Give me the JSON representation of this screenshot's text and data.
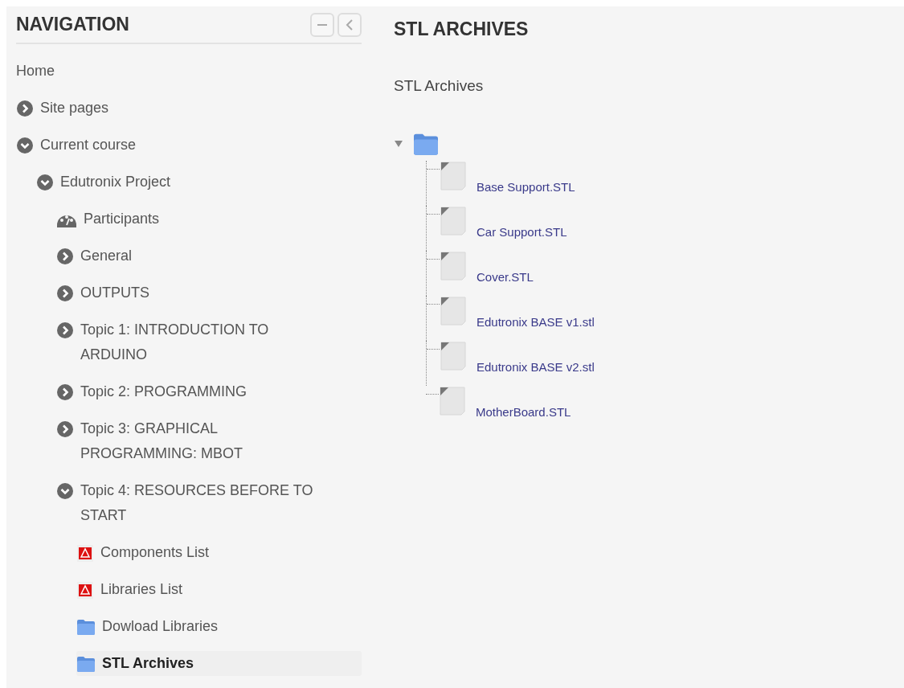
{
  "navigation": {
    "title": "NAVIGATION",
    "items": [
      {
        "kind": "link",
        "label": "Home"
      },
      {
        "kind": "branch",
        "label": "Site pages",
        "expanded": false
      },
      {
        "kind": "branch",
        "label": "Current course",
        "expanded": true,
        "children": [
          {
            "kind": "branch",
            "label": "Edutronix Project",
            "expanded": true,
            "children": [
              {
                "kind": "participants",
                "label": "Participants"
              },
              {
                "kind": "branch",
                "label": "General",
                "expanded": false
              },
              {
                "kind": "branch",
                "label": "OUTPUTS",
                "expanded": false
              },
              {
                "kind": "branch",
                "label": "Topic 1: INTRODUCTION TO ARDUINO",
                "expanded": false
              },
              {
                "kind": "branch",
                "label": "Topic 2: PROGRAMMING",
                "expanded": false
              },
              {
                "kind": "branch",
                "label": "Topic 3: GRAPHICAL PROGRAMMING: MBOT",
                "expanded": false
              },
              {
                "kind": "branch",
                "label": "Topic 4: RESOURCES BEFORE TO START",
                "expanded": true,
                "children": [
                  {
                    "kind": "pdf",
                    "label": "Components List",
                    "selected": false
                  },
                  {
                    "kind": "pdf",
                    "label": "Libraries List",
                    "selected": false
                  },
                  {
                    "kind": "folder",
                    "label": "Dowload Libraries",
                    "selected": false
                  },
                  {
                    "kind": "folder",
                    "label": "STL Archives",
                    "selected": true
                  }
                ]
              }
            ]
          }
        ]
      }
    ]
  },
  "main": {
    "title": "STL ARCHIVES",
    "subtitle": "STL Archives",
    "folder": {
      "expanded": true,
      "files": [
        "Base Support.STL",
        "Car Support.STL",
        "Cover.STL",
        "Edutronix BASE v1.stl",
        "Edutronix BASE v2.stl",
        "MotherBoard.STL"
      ]
    }
  }
}
